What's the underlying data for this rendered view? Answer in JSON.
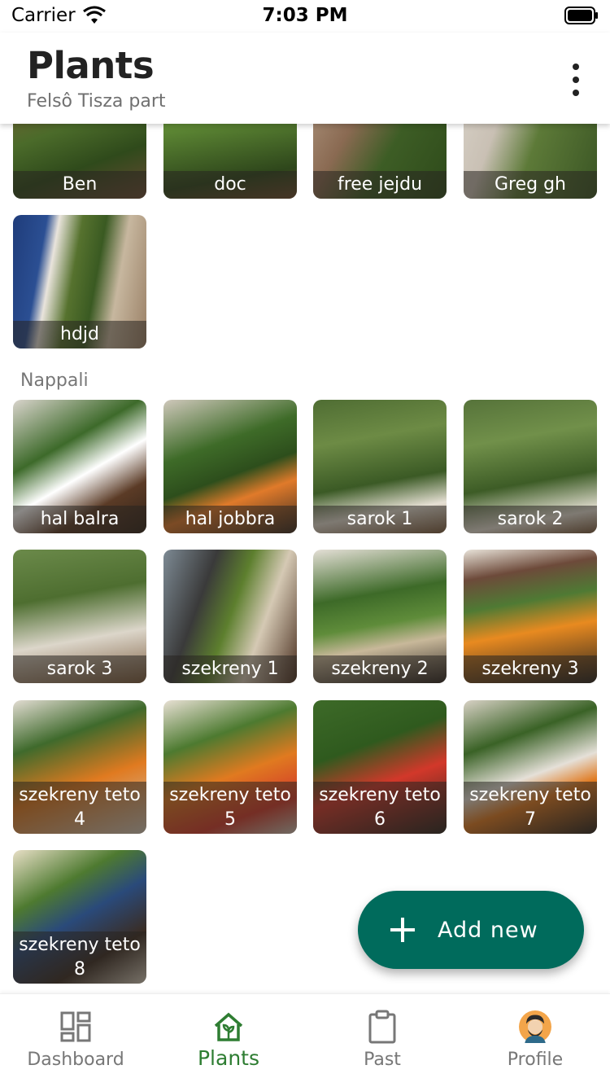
{
  "status_bar": {
    "carrier": "Carrier",
    "time": "7:03 PM"
  },
  "header": {
    "title": "Plants",
    "subtitle": "Felsô Tisza part"
  },
  "top_group": {
    "items": [
      {
        "label": "Ben"
      },
      {
        "label": "doc"
      },
      {
        "label": "free jejdu"
      },
      {
        "label": "Greg gh"
      },
      {
        "label": "hdjd"
      }
    ]
  },
  "nappali": {
    "title": "Nappali",
    "items": [
      {
        "label": "hal balra"
      },
      {
        "label": "hal jobbra"
      },
      {
        "label": "sarok 1"
      },
      {
        "label": "sarok 2"
      },
      {
        "label": "sarok 3"
      },
      {
        "label": "szekreny 1"
      },
      {
        "label": "szekreny 2"
      },
      {
        "label": "szekreny 3"
      },
      {
        "label": "szekreny teto 4"
      },
      {
        "label": "szekreny teto 5"
      },
      {
        "label": "szekreny teto 6"
      },
      {
        "label": "szekreny teto 7"
      },
      {
        "label": "szekreny teto 8"
      }
    ]
  },
  "fab": {
    "label": "Add new"
  },
  "bottom_nav": {
    "items": [
      {
        "label": "Dashboard",
        "icon": "dashboard-icon"
      },
      {
        "label": "Plants",
        "icon": "home-plant-icon",
        "active": true
      },
      {
        "label": "Past",
        "icon": "clipboard-icon"
      },
      {
        "label": "Profile",
        "icon": "avatar"
      }
    ]
  },
  "colors": {
    "accent": "#006b5c",
    "active_nav": "#2e7d32"
  }
}
